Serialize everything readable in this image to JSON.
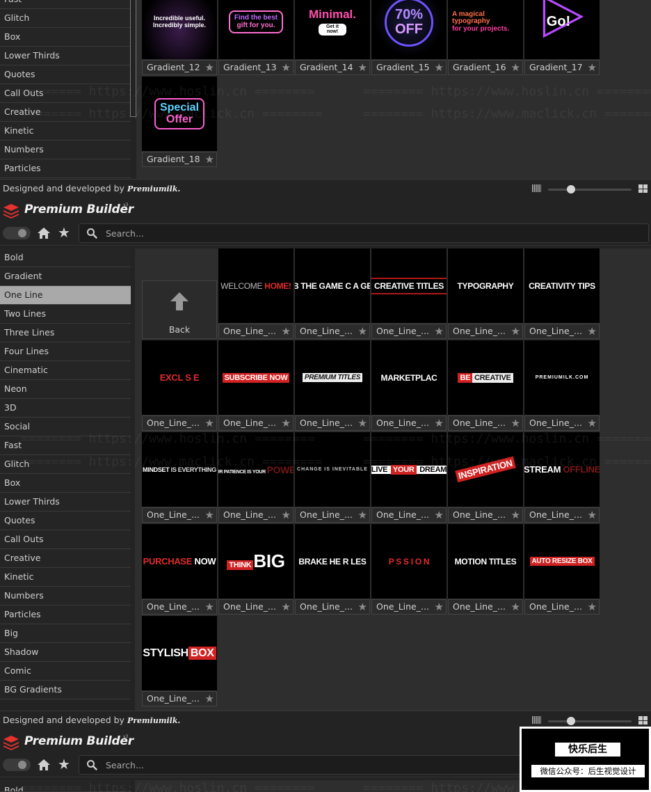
{
  "app": {
    "title": "Premium Builder",
    "version": "v3",
    "search_placeholder": "Search...",
    "credit_text": "Designed and developed by",
    "credit_brand": "Premiumilk."
  },
  "top_sidebar": [
    "Fast",
    "Glitch",
    "Box",
    "Lower Thirds",
    "Quotes",
    "Call Outs",
    "Creative",
    "Kinetic",
    "Numbers",
    "Particles"
  ],
  "top_tiles": [
    {
      "label": "Gradient_12",
      "t1": "Incredible useful.",
      "t2": "Incredibly simple."
    },
    {
      "label": "Gradient_13",
      "t1": "Find the best",
      "t2": "gift for you."
    },
    {
      "label": "Gradient_14",
      "t1": "Minimal.",
      "t2": "Get it now!"
    },
    {
      "label": "Gradient_15",
      "t1": "70%",
      "t2": "OFF"
    },
    {
      "label": "Gradient_16",
      "t1": "A magical typography",
      "t2": "for your projects."
    },
    {
      "label": "Gradient_17",
      "t1": "Go!",
      "t2": ""
    },
    {
      "label": "Gradient_18",
      "t1": "Special",
      "t2": "Offer"
    }
  ],
  "main_sidebar": [
    {
      "label": "Bold",
      "active": false
    },
    {
      "label": "Gradient",
      "active": false
    },
    {
      "label": "One Line",
      "active": true
    },
    {
      "label": "Two Lines",
      "active": false
    },
    {
      "label": "Three Lines",
      "active": false
    },
    {
      "label": "Four Lines",
      "active": false
    },
    {
      "label": "Cinematic",
      "active": false
    },
    {
      "label": "Neon",
      "active": false
    },
    {
      "label": "3D",
      "active": false
    },
    {
      "label": "Social",
      "active": false
    },
    {
      "label": "Fast",
      "active": false
    },
    {
      "label": "Glitch",
      "active": false
    },
    {
      "label": "Box",
      "active": false
    },
    {
      "label": "Lower Thirds",
      "active": false
    },
    {
      "label": "Quotes",
      "active": false
    },
    {
      "label": "Call Outs",
      "active": false
    },
    {
      "label": "Creative",
      "active": false
    },
    {
      "label": "Kinetic",
      "active": false
    },
    {
      "label": "Numbers",
      "active": false
    },
    {
      "label": "Particles",
      "active": false
    },
    {
      "label": "Big",
      "active": false
    },
    {
      "label": "Shadow",
      "active": false
    },
    {
      "label": "Comic",
      "active": false
    },
    {
      "label": "BG Gradients",
      "active": false
    }
  ],
  "back_label": "Back",
  "main_tiles": [
    {
      "label": "One_Line_...",
      "a": "WELCOME ",
      "b": "HOME!",
      "style": "welcome"
    },
    {
      "label": "One_Line_...",
      "a": "B  THE GAME C  A  GE",
      "b": "",
      "style": "plain"
    },
    {
      "label": "One_Line_...",
      "a": "CREATIVE TITLES",
      "b": "",
      "style": "outline"
    },
    {
      "label": "One_Line_...",
      "a": "TYPOGRAPHY",
      "b": "",
      "style": "plain"
    },
    {
      "label": "One_Line_...",
      "a": "CREATIVITY TIPS",
      "b": "",
      "style": "plain"
    },
    {
      "label": "One_Line_...",
      "a": "EXCL  S   E",
      "b": "",
      "style": "redtext"
    },
    {
      "label": "One_Line_...",
      "a": "SUBSCRIBE NOW",
      "b": "",
      "style": "redbox"
    },
    {
      "label": "One_Line_...",
      "a": "PREMIUM TITLES",
      "b": "",
      "style": "whitebox"
    },
    {
      "label": "One_Line_...",
      "a": "MARKETPLAC",
      "b": "",
      "style": "plain"
    },
    {
      "label": "One_Line_...",
      "a": "BE",
      "b": "CREATIVE",
      "style": "be"
    },
    {
      "label": "One_Line_...",
      "a": "PREMIUMILK.COM",
      "b": "",
      "style": "small"
    },
    {
      "label": "One_Line_...",
      "a": "MINDSET ",
      "b": "IS EVERYTHING",
      "style": "mindset"
    },
    {
      "label": "One_Line_...",
      "a": "YOUR PATIENCE IS YOUR ",
      "b": "POWER",
      "style": "patience"
    },
    {
      "label": "One_Line_...",
      "a": "CHANGE IS INEVITABLE",
      "b": "",
      "style": "tiny"
    },
    {
      "label": "One_Line_...",
      "a": "LIVE ",
      "b": "YOUR",
      "c": " DREAM",
      "style": "live"
    },
    {
      "label": "One_Line_...",
      "a": "INSPIRATION",
      "b": "",
      "style": "tilt"
    },
    {
      "label": "One_Line_...",
      "a": "STREAM ",
      "b": "OFFLINE",
      "style": "stream"
    },
    {
      "label": "One_Line_...",
      "a": "PURCHASE ",
      "b": "NOW",
      "style": "purchase"
    },
    {
      "label": "One_Line_...",
      "a": "THINK",
      "b": "BIG",
      "style": "think"
    },
    {
      "label": "One_Line_...",
      "a": "BRAKE  HE  R  LES",
      "b": "",
      "style": "plain"
    },
    {
      "label": "One_Line_...",
      "a": "P  S  S  I  O  N",
      "b": "",
      "style": "passion"
    },
    {
      "label": "One_Line_...",
      "a": "MOTION TITLES",
      "b": "",
      "style": "plain"
    },
    {
      "label": "One_Line_...",
      "a": "AUTO RESIZE BOX",
      "b": "",
      "style": "autoresize"
    },
    {
      "label": "One_Line_...",
      "a": "STYLISH",
      "b": "BOX",
      "style": "stylish"
    }
  ],
  "bottom_sidebar": [
    "Bold"
  ],
  "watermarks": [
    "======== https://www.hoslin.cn ========",
    "======== https://www.maclick.cn ========"
  ],
  "wx_badge": {
    "title": "快乐后生",
    "subtitle": "微信公众号：后生视觉设计"
  }
}
